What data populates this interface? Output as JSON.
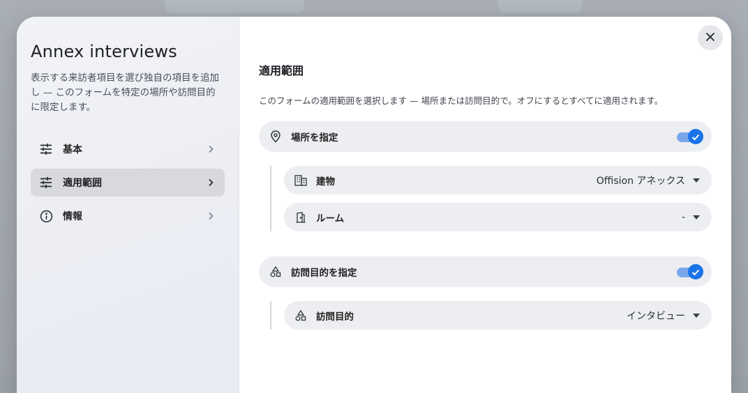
{
  "dialog": {
    "title": "Annex interviews",
    "description": "表示する来訪者項目を選び独自の項目を追加し — このフォームを特定の場所や訪問目的に限定します。"
  },
  "nav": {
    "items": [
      {
        "label": "基本",
        "icon": "tune-icon",
        "active": false
      },
      {
        "label": "適用範囲",
        "icon": "tune-icon",
        "active": true
      },
      {
        "label": "情報",
        "icon": "info-icon",
        "active": false
      }
    ]
  },
  "scope": {
    "title": "適用範囲",
    "description": "このフォームの適用範囲を選択します — 場所または訪問目的で。オフにするとすべてに適用されます。",
    "location": {
      "label": "場所を指定",
      "icon": "location-pin-icon",
      "enabled": true,
      "fields": [
        {
          "label": "建物",
          "value": "Offision アネックス",
          "icon": "building-icon"
        },
        {
          "label": "ルーム",
          "value": "-",
          "icon": "door-icon"
        }
      ]
    },
    "purpose": {
      "label": "訪問目的を指定",
      "icon": "category-icon",
      "enabled": true,
      "fields": [
        {
          "label": "訪問目的",
          "value": "インタビュー",
          "icon": "category-icon"
        }
      ]
    }
  },
  "colors": {
    "accent": "#1a73e8",
    "accent_track": "#7aa7ea",
    "pill_bg": "#eceef1",
    "nav_active_bg": "#d7d9de"
  }
}
